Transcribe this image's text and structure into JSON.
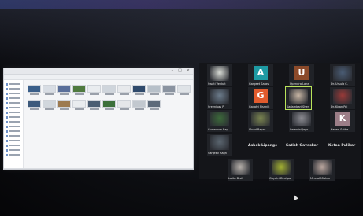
{
  "explorer": {
    "window_controls": [
      "–",
      "□",
      "×"
    ]
  },
  "gallery": {
    "participants": [
      {
        "name": "Swati Venkat",
        "kind": "video",
        "color": "#d9dcd6"
      },
      {
        "name": "Gargeet Saras",
        "kind": "letter",
        "letter": "A",
        "color": "#1e9aa3"
      },
      {
        "name": "Upendra Lane",
        "kind": "letter",
        "letter": "U",
        "color": "#8b4a2a"
      },
      {
        "name": "Dr. Ursula C.",
        "kind": "video",
        "color": "#4a5c74"
      },
      {
        "name": "Sreenivas P.",
        "kind": "video",
        "color": "#6c7c8c"
      },
      {
        "name": "Gayatri Pisnnik",
        "kind": "letter",
        "letter": "G",
        "color": "#e25b2d"
      },
      {
        "name": "Kadambari Sher",
        "kind": "video",
        "color": "#c8b6a4"
      },
      {
        "name": "Dr. Kiran Pai",
        "kind": "video",
        "color": "#9a3a38"
      },
      {
        "name": "Gunwarna Bap",
        "kind": "video",
        "color": "#3c6a3a"
      },
      {
        "name": "Vinod Bapat",
        "kind": "video",
        "color": "#7a8450"
      },
      {
        "name": "Swamini Jayo",
        "kind": "video",
        "color": "#8c8c92"
      },
      {
        "name": "Kaveri Sathe",
        "kind": "letter",
        "letter": "K",
        "color": "#9c7e88"
      },
      {
        "name": "Sanjeev Ragh",
        "kind": "video",
        "color": "#5b6670"
      },
      {
        "name": "Lalita Dixit",
        "kind": "video",
        "color": "#b8b2ac"
      },
      {
        "name": "Gayatri Deshpa",
        "kind": "video",
        "color": "#a4b232"
      },
      {
        "name": "Mrunal Mishra",
        "kind": "video",
        "color": "#bca8a0"
      }
    ],
    "text_participants": [
      "Ashok Lipange",
      "Satish Gavaskar",
      "Ketan Pulikar"
    ]
  }
}
